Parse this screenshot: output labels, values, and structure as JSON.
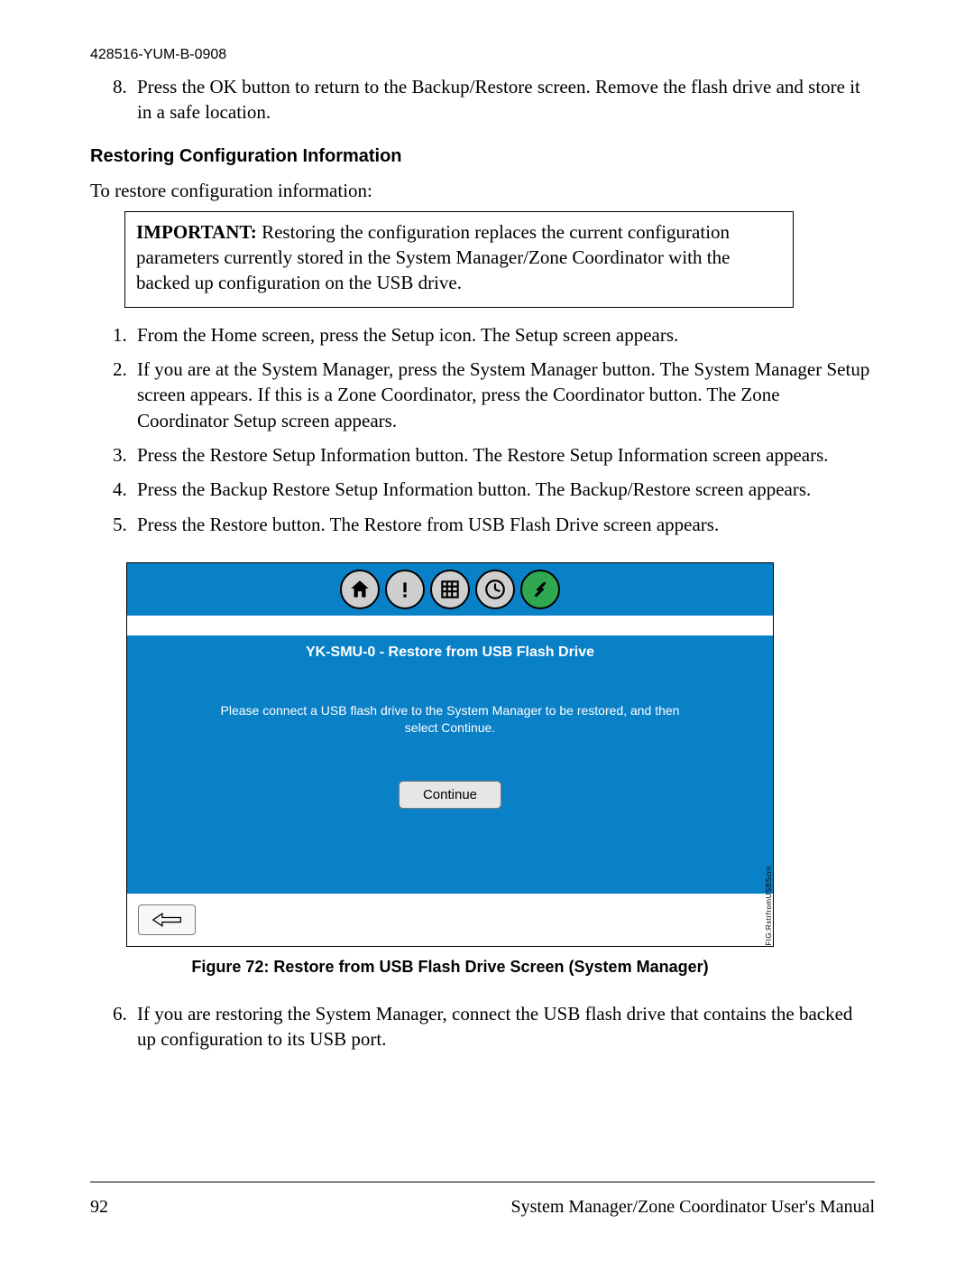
{
  "header": {
    "doc_id": "428516-YUM-B-0908"
  },
  "step8": "Press the OK button to return to the Backup/Restore screen. Remove the flash drive and store it in a safe location.",
  "section_heading": "Restoring Configuration Information",
  "lead_in": "To restore configuration information:",
  "important": {
    "label": "IMPORTANT:",
    "text": " Restoring the configuration replaces the current configuration parameters currently stored in the System Manager/Zone Coordinator with the backed up configuration on the USB drive."
  },
  "steps": [
    "From the Home screen, press the Setup icon. The Setup screen appears.",
    "If you are at the System Manager, press the System Manager button. The System Manager Setup screen appears. If this is a Zone Coordinator, press the Coordinator button. The Zone Coordinator Setup screen appears.",
    "Press the Restore Setup Information button. The Restore Setup Information screen appears.",
    "Press the Backup Restore Setup Information button. The Backup/Restore screen appears.",
    "Press the Restore button. The Restore from USB Flash Drive screen appears."
  ],
  "device": {
    "title": "YK-SMU-0 - Restore from USB Flash Drive",
    "message": "Please connect a USB flash drive to the System Manager to be restored, and then select Continue.",
    "continue": "Continue",
    "side_label": "FIG:RstrfromUSBScrn",
    "icons": {
      "home": "home-icon",
      "alert": "alert-icon",
      "grid": "grid-icon",
      "schedule": "schedule-icon",
      "tools": "tools-icon"
    }
  },
  "figure_caption": "Figure 72: Restore from USB Flash Drive Screen (System Manager)",
  "step6": "If you are restoring the System Manager, connect the USB flash drive that contains the backed up configuration to its USB port.",
  "footer": {
    "page": "92",
    "manual": "System Manager/Zone Coordinator User's Manual"
  }
}
